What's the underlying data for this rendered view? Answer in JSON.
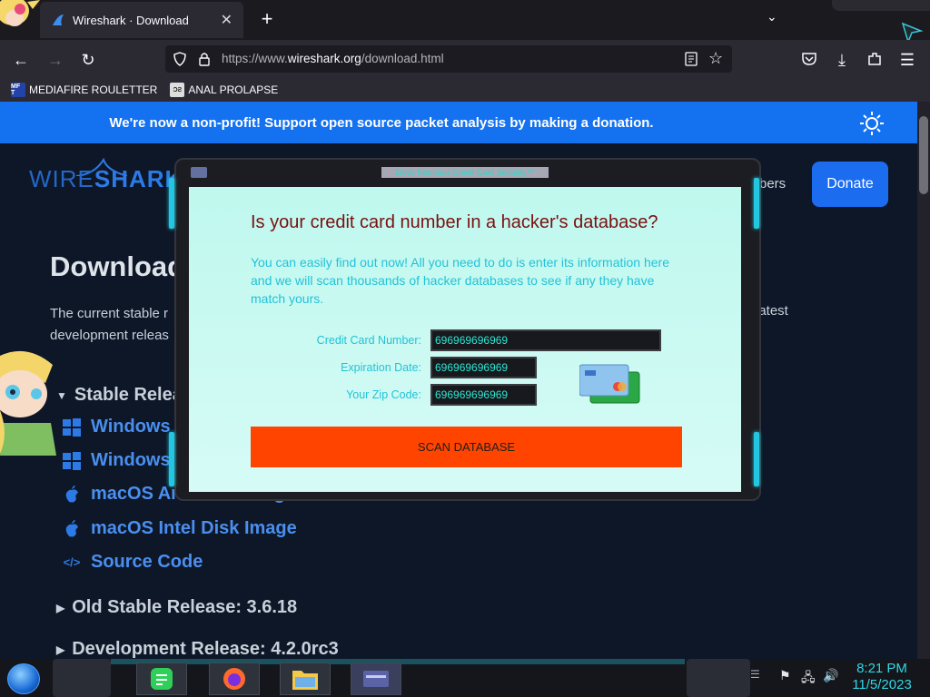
{
  "browser": {
    "tab_title": "Wireshark · Download",
    "url_prefix": "https://www.",
    "url_host": "wireshark.org",
    "url_path": "/download.html",
    "bookmarks": [
      {
        "label": "MEDIAFIRE ROULETTER",
        "icon_text": "MF T"
      },
      {
        "label": "ANAL PROLAPSE",
        "icon_text": "ƆƧ"
      }
    ]
  },
  "page": {
    "banner": "We're now a non-profit! Support open source packet analysis by making a donation.",
    "logo_wire": "WIRE",
    "logo_shark": "SHARK",
    "nav_members": "bers",
    "donate_label": "Donate",
    "title": "Download",
    "desc_left": "The current stable r development releas",
    "desc_right": "latest",
    "stable_heading": "Stable Release",
    "downloads": [
      {
        "label": "Windows",
        "icon": "windows-icon"
      },
      {
        "label": "Windows",
        "icon": "windows-icon"
      },
      {
        "label": "macOS Arm Disk Image",
        "icon": "apple-icon"
      },
      {
        "label": "macOS Intel Disk Image",
        "icon": "apple-icon"
      },
      {
        "label": "Source Code",
        "icon": "code-icon"
      }
    ],
    "old_stable": "Old Stable Release: 3.6.18",
    "dev_release": "Development Release: 4.2.0rc3"
  },
  "popup": {
    "window_title": "Dove Normous Credit Card Security™",
    "question": "Is your credit card number in a hacker's database?",
    "paragraph": "You can easily find out now! All you need to do is enter its information here and we will scan thousands of hacker databases to see if any they have match yours.",
    "fields": [
      {
        "label": "Credit Card Number:",
        "value": "696969696969"
      },
      {
        "label": "Expiration Date:",
        "value": "696969696969"
      },
      {
        "label": "Your Zip Code:",
        "value": "696969696969"
      }
    ],
    "scan_label": "SCAN DATABASE"
  },
  "taskbar": {
    "time": "8:21 PM",
    "date": "11/5/2023"
  },
  "colors": {
    "accent_blue": "#1471f0",
    "scan_button": "#ff4400",
    "popup_text": "#22c2d8",
    "question_text": "#7a1010"
  }
}
